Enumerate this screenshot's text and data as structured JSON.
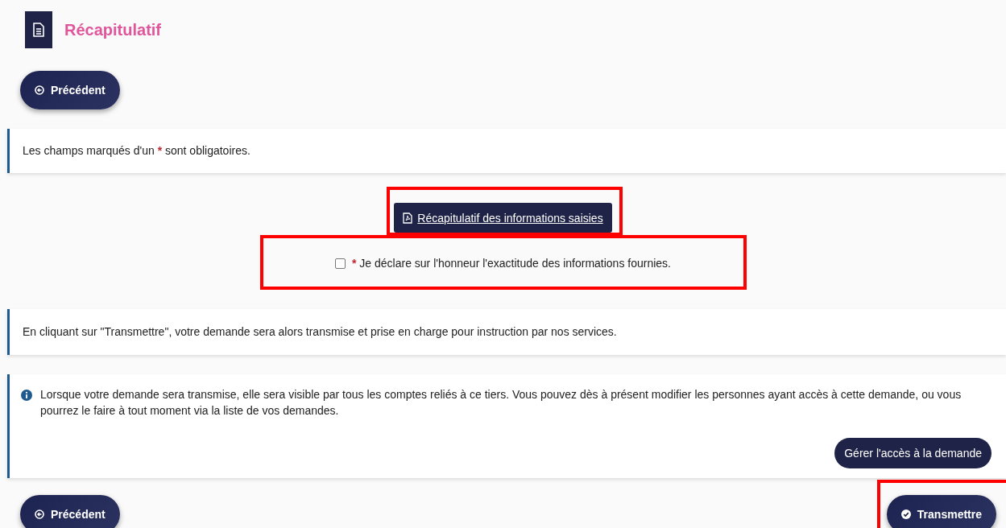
{
  "header": {
    "title": "Récapitulatif"
  },
  "top_back_button": {
    "label": "Précédent"
  },
  "required_notice": {
    "before": "Les champs marqués d'un",
    "mark": "*",
    "after": "sont obligatoires."
  },
  "summary_button": {
    "label": "Récapitulatif des informations saisies",
    "highlighted": true
  },
  "declaration": {
    "mark": "*",
    "label": "Je déclare sur l'honneur l'exactitude des informations fournies.",
    "checked": false,
    "highlighted": true
  },
  "transmit_notice": {
    "text": "En cliquant sur \"Transmettre\", votre demande sera alors transmise et prise en charge pour instruction par nos services."
  },
  "info_card": {
    "text": "Lorsque votre demande sera transmise, elle sera visible par tous les comptes reliés à ce tiers. Vous pouvez dès à présent modifier les personnes ayant accès à cette demande, ou vous pourrez le faire à tout moment via la liste de vos demandes.",
    "button": "Gérer l'accès à la demande"
  },
  "footer": {
    "back_button": {
      "label": "Précédent"
    },
    "submit_button": {
      "label": "Transmettre",
      "highlighted": true
    }
  }
}
